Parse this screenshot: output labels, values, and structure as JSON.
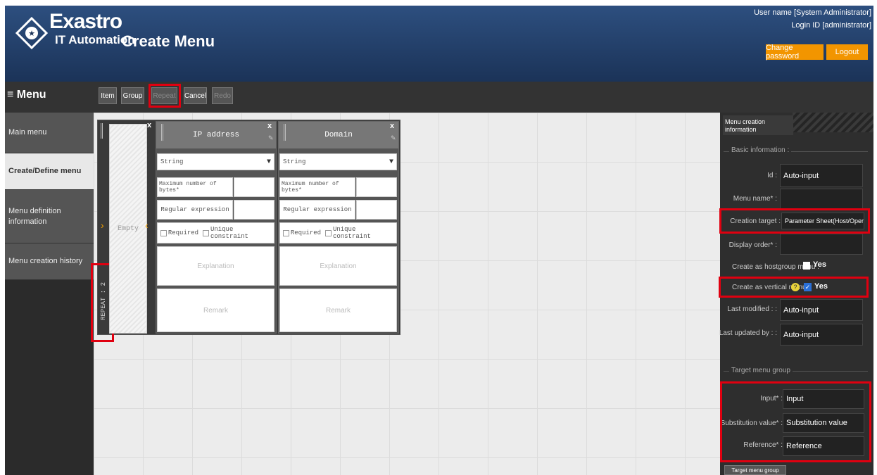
{
  "header": {
    "brand": "Exastro",
    "brand_sub": "IT Automation",
    "title": "Create Menu",
    "user_name": "User name [System Administrator]",
    "login_id": "Login ID [administrator]",
    "change_password": "Change password",
    "logout": "Logout"
  },
  "menu": {
    "title": "Menu",
    "items": [
      {
        "label": "Main menu"
      },
      {
        "label": "Create/Define menu"
      },
      {
        "label": "Menu definition information"
      },
      {
        "label": "Menu creation history"
      }
    ]
  },
  "toolbar": {
    "item": "Item",
    "group": "Group",
    "repeat": "Repeat",
    "cancel": "Cancel",
    "redo": "Redo"
  },
  "repeat_block": {
    "vertical_label": "REPEAT : 2",
    "empty_label": "Empty",
    "close": "x"
  },
  "columns": [
    {
      "name": "IP address",
      "type": "String",
      "max_bytes_label": "Maximum number of bytes*",
      "regex_label": "Regular expression",
      "required_label": "Required",
      "unique_label": "Unique constraint",
      "explanation": "Explanation",
      "remark": "Remark",
      "close": "x"
    },
    {
      "name": "Domain",
      "type": "String",
      "max_bytes_label": "Maximum number of bytes*",
      "regex_label": "Regular expression",
      "required_label": "Required",
      "unique_label": "Unique constraint",
      "explanation": "Explanation",
      "remark": "Remark",
      "close": "x"
    }
  ],
  "panel": {
    "tab": "Menu creation information",
    "basic_legend": "Basic information :",
    "id_label": "Id :",
    "id_value": "Auto-input",
    "menu_name_label": "Menu name* :",
    "creation_target_label": "Creation target :",
    "creation_target_value": "Parameter Sheet(Host/Operat",
    "display_order_label": "Display order* :",
    "hostgroup_label": "Create as hostgroup menu :",
    "hostgroup_yes": "Yes",
    "vertical_label": "Create as vertical menu",
    "vertical_yes": "Yes",
    "last_modified_label": "Last modified : :",
    "last_modified_value": "Auto-input",
    "last_updated_label": "Last updated by : :",
    "last_updated_value": "Auto-input",
    "target_legend": "Target menu group",
    "input_label": "Input* :",
    "input_value": "Input",
    "subst_label": "Substitution value* :",
    "subst_value": "Substitution value",
    "ref_label": "Reference* :",
    "ref_value": "Reference",
    "target_btn": "Target menu group"
  },
  "colors": {
    "header_bg": "#1b3358",
    "accent_orange": "#f29500",
    "highlight_red": "#e00010"
  }
}
